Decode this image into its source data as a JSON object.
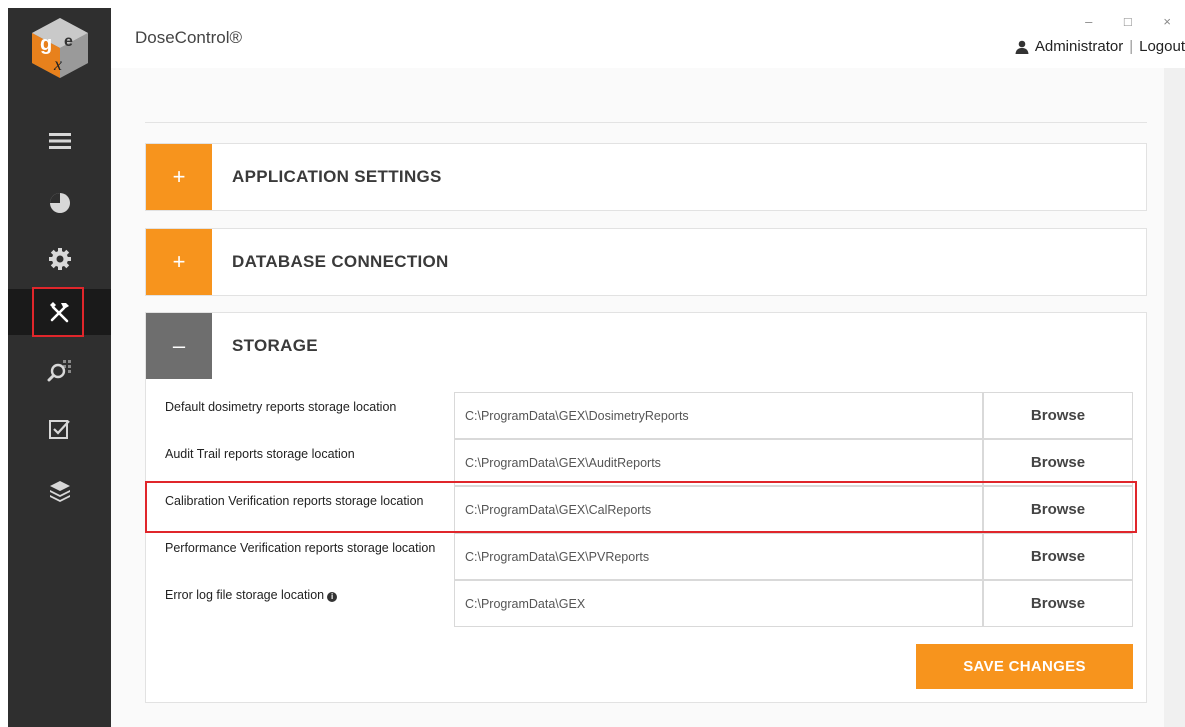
{
  "header": {
    "app_title": "DoseControl®",
    "window_controls": "– □ ×",
    "user_name": "Administrator",
    "separator": "|",
    "logout_label": "Logout"
  },
  "sidebar": {
    "items": [
      {
        "icon": "menu-icon",
        "name": "sidebar-item-menu"
      },
      {
        "icon": "dashboard-icon",
        "name": "sidebar-item-dashboard"
      },
      {
        "icon": "gear-icon",
        "name": "sidebar-item-settings"
      },
      {
        "icon": "tools-icon",
        "name": "sidebar-item-tools",
        "active": true
      },
      {
        "icon": "search-grid-icon",
        "name": "sidebar-item-search"
      },
      {
        "icon": "checkbox-icon",
        "name": "sidebar-item-verification"
      },
      {
        "icon": "layers-icon",
        "name": "sidebar-item-layers"
      }
    ]
  },
  "panels": {
    "app_settings": {
      "toggle": "+",
      "title": "APPLICATION SETTINGS"
    },
    "db_connection": {
      "toggle": "+",
      "title": "DATABASE CONNECTION"
    },
    "storage": {
      "toggle": "–",
      "title": "STORAGE"
    }
  },
  "storage_rows": [
    {
      "label": "Default dosimetry reports storage location",
      "value": "C:\\ProgramData\\GEX\\DosimetryReports",
      "button": "Browse"
    },
    {
      "label": "Audit Trail reports storage location",
      "value": "C:\\ProgramData\\GEX\\AuditReports",
      "button": "Browse"
    },
    {
      "label": "Calibration Verification reports storage location",
      "value": "C:\\ProgramData\\GEX\\CalReports",
      "button": "Browse"
    },
    {
      "label": "Performance Verification reports storage location",
      "value": "C:\\ProgramData\\GEX\\PVReports",
      "button": "Browse"
    },
    {
      "label": "Error log file storage location",
      "value": "C:\\ProgramData\\GEX",
      "button": "Browse"
    }
  ],
  "save_label": "SAVE CHANGES",
  "colors": {
    "accent": "#f7941d",
    "sidebar": "#2f2f2f",
    "highlight": "#e0262b"
  }
}
